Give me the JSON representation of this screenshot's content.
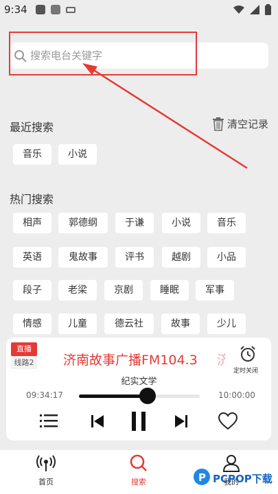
{
  "status_bar": {
    "time": "9:34"
  },
  "search": {
    "placeholder": "搜索电台关键字"
  },
  "recent": {
    "title": "最近搜索",
    "clear_label": "清空记录",
    "items": [
      "音乐",
      "小说"
    ]
  },
  "hot": {
    "title": "热门搜索",
    "items": [
      "相声",
      "郭德纲",
      "于谦",
      "小说",
      "音乐",
      "英语",
      "鬼故事",
      "评书",
      "越剧",
      "小品",
      "段子",
      "老梁",
      "京剧",
      "睡眠",
      "军事",
      "情感",
      "儿童",
      "德云社",
      "故事",
      "少儿"
    ]
  },
  "player": {
    "live_label": "直播",
    "line_label": "线路2",
    "station": "济南故事广播FM104.3",
    "station_next": "济",
    "program": "纪实文学",
    "time_start": "09:34:17",
    "time_end": "10:00:00",
    "progress": 0.57,
    "timer_label": "定时关闭"
  },
  "nav": {
    "items": [
      {
        "label": "首页"
      },
      {
        "label": "搜索"
      },
      {
        "label": "我的"
      }
    ]
  },
  "watermark": {
    "text": "PCPOP下载"
  },
  "colors": {
    "accent": "#e53935",
    "annotation": "#e53935"
  }
}
